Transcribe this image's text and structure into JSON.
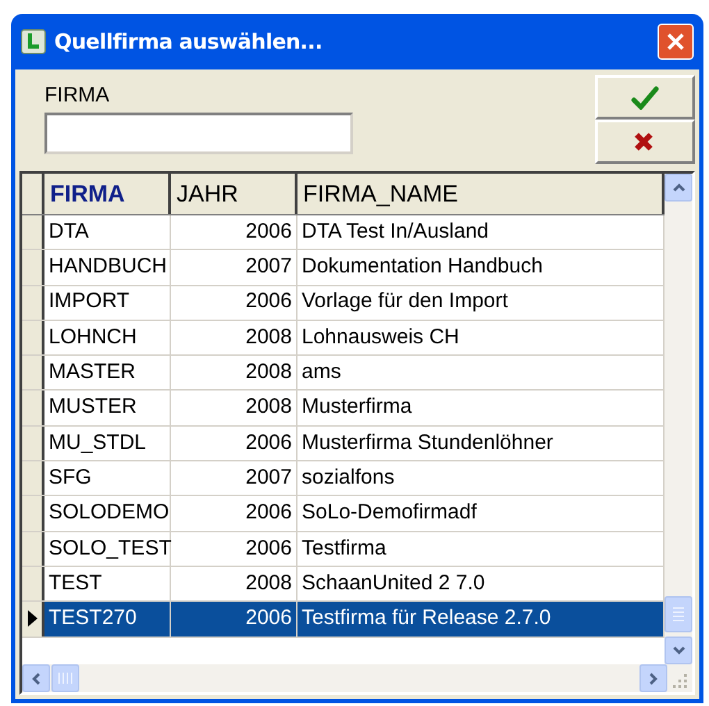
{
  "window": {
    "title": "Quellfirma auswählen..."
  },
  "filter": {
    "label": "FIRMA"
  },
  "buttons": [
    {
      "kind": "ok"
    },
    {
      "kind": "cancel"
    }
  ],
  "table": {
    "columns": [
      {
        "label": "FIRMA",
        "sorted": true
      },
      {
        "label": "JAHR",
        "sorted": false
      },
      {
        "label": "FIRMA_NAME",
        "sorted": false
      }
    ],
    "rows": [
      {
        "cells": [
          "DTA",
          "2006",
          "DTA Test In/Ausland"
        ],
        "selected": false
      },
      {
        "cells": [
          "HANDBUCH",
          "2007",
          "Dokumentation Handbuch"
        ],
        "selected": false
      },
      {
        "cells": [
          "IMPORT",
          "2006",
          "Vorlage für den Import"
        ],
        "selected": false
      },
      {
        "cells": [
          "LOHNCH",
          "2008",
          "Lohnausweis CH"
        ],
        "selected": false
      },
      {
        "cells": [
          "MASTER",
          "2008",
          "ams"
        ],
        "selected": false
      },
      {
        "cells": [
          "MUSTER",
          "2008",
          "Musterfirma"
        ],
        "selected": false
      },
      {
        "cells": [
          "MU_STDL",
          "2006",
          "Musterfirma Stundenlöhner"
        ],
        "selected": false
      },
      {
        "cells": [
          "SFG",
          "2007",
          "sozialfons"
        ],
        "selected": false
      },
      {
        "cells": [
          "SOLODEMO",
          "2006",
          "SoLo-Demofirmadf"
        ],
        "selected": false
      },
      {
        "cells": [
          "SOLO_TEST",
          "2006",
          "Testfirma"
        ],
        "selected": false
      },
      {
        "cells": [
          "TEST",
          "2008",
          "SchaanUnited 2 7.0"
        ],
        "selected": false
      },
      {
        "cells": [
          "TEST270",
          "2006",
          "Testfirma für Release 2.7.0"
        ],
        "selected": true
      }
    ]
  }
}
